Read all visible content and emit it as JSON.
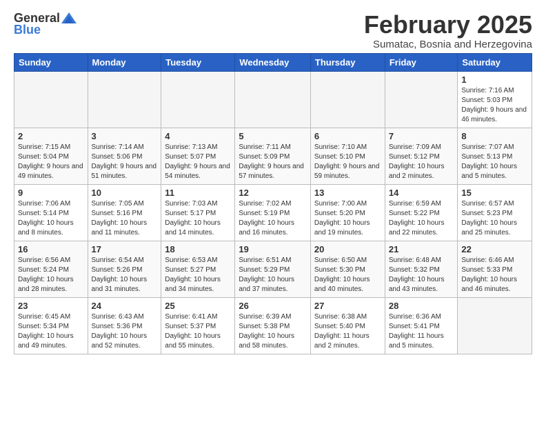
{
  "logo": {
    "general": "General",
    "blue": "Blue"
  },
  "header": {
    "month_year": "February 2025",
    "location": "Sumatac, Bosnia and Herzegovina"
  },
  "weekdays": [
    "Sunday",
    "Monday",
    "Tuesday",
    "Wednesday",
    "Thursday",
    "Friday",
    "Saturday"
  ],
  "weeks": [
    [
      {
        "day": "",
        "info": ""
      },
      {
        "day": "",
        "info": ""
      },
      {
        "day": "",
        "info": ""
      },
      {
        "day": "",
        "info": ""
      },
      {
        "day": "",
        "info": ""
      },
      {
        "day": "",
        "info": ""
      },
      {
        "day": "1",
        "info": "Sunrise: 7:16 AM\nSunset: 5:03 PM\nDaylight: 9 hours and 46 minutes."
      }
    ],
    [
      {
        "day": "2",
        "info": "Sunrise: 7:15 AM\nSunset: 5:04 PM\nDaylight: 9 hours and 49 minutes."
      },
      {
        "day": "3",
        "info": "Sunrise: 7:14 AM\nSunset: 5:06 PM\nDaylight: 9 hours and 51 minutes."
      },
      {
        "day": "4",
        "info": "Sunrise: 7:13 AM\nSunset: 5:07 PM\nDaylight: 9 hours and 54 minutes."
      },
      {
        "day": "5",
        "info": "Sunrise: 7:11 AM\nSunset: 5:09 PM\nDaylight: 9 hours and 57 minutes."
      },
      {
        "day": "6",
        "info": "Sunrise: 7:10 AM\nSunset: 5:10 PM\nDaylight: 9 hours and 59 minutes."
      },
      {
        "day": "7",
        "info": "Sunrise: 7:09 AM\nSunset: 5:12 PM\nDaylight: 10 hours and 2 minutes."
      },
      {
        "day": "8",
        "info": "Sunrise: 7:07 AM\nSunset: 5:13 PM\nDaylight: 10 hours and 5 minutes."
      }
    ],
    [
      {
        "day": "9",
        "info": "Sunrise: 7:06 AM\nSunset: 5:14 PM\nDaylight: 10 hours and 8 minutes."
      },
      {
        "day": "10",
        "info": "Sunrise: 7:05 AM\nSunset: 5:16 PM\nDaylight: 10 hours and 11 minutes."
      },
      {
        "day": "11",
        "info": "Sunrise: 7:03 AM\nSunset: 5:17 PM\nDaylight: 10 hours and 14 minutes."
      },
      {
        "day": "12",
        "info": "Sunrise: 7:02 AM\nSunset: 5:19 PM\nDaylight: 10 hours and 16 minutes."
      },
      {
        "day": "13",
        "info": "Sunrise: 7:00 AM\nSunset: 5:20 PM\nDaylight: 10 hours and 19 minutes."
      },
      {
        "day": "14",
        "info": "Sunrise: 6:59 AM\nSunset: 5:22 PM\nDaylight: 10 hours and 22 minutes."
      },
      {
        "day": "15",
        "info": "Sunrise: 6:57 AM\nSunset: 5:23 PM\nDaylight: 10 hours and 25 minutes."
      }
    ],
    [
      {
        "day": "16",
        "info": "Sunrise: 6:56 AM\nSunset: 5:24 PM\nDaylight: 10 hours and 28 minutes."
      },
      {
        "day": "17",
        "info": "Sunrise: 6:54 AM\nSunset: 5:26 PM\nDaylight: 10 hours and 31 minutes."
      },
      {
        "day": "18",
        "info": "Sunrise: 6:53 AM\nSunset: 5:27 PM\nDaylight: 10 hours and 34 minutes."
      },
      {
        "day": "19",
        "info": "Sunrise: 6:51 AM\nSunset: 5:29 PM\nDaylight: 10 hours and 37 minutes."
      },
      {
        "day": "20",
        "info": "Sunrise: 6:50 AM\nSunset: 5:30 PM\nDaylight: 10 hours and 40 minutes."
      },
      {
        "day": "21",
        "info": "Sunrise: 6:48 AM\nSunset: 5:32 PM\nDaylight: 10 hours and 43 minutes."
      },
      {
        "day": "22",
        "info": "Sunrise: 6:46 AM\nSunset: 5:33 PM\nDaylight: 10 hours and 46 minutes."
      }
    ],
    [
      {
        "day": "23",
        "info": "Sunrise: 6:45 AM\nSunset: 5:34 PM\nDaylight: 10 hours and 49 minutes."
      },
      {
        "day": "24",
        "info": "Sunrise: 6:43 AM\nSunset: 5:36 PM\nDaylight: 10 hours and 52 minutes."
      },
      {
        "day": "25",
        "info": "Sunrise: 6:41 AM\nSunset: 5:37 PM\nDaylight: 10 hours and 55 minutes."
      },
      {
        "day": "26",
        "info": "Sunrise: 6:39 AM\nSunset: 5:38 PM\nDaylight: 10 hours and 58 minutes."
      },
      {
        "day": "27",
        "info": "Sunrise: 6:38 AM\nSunset: 5:40 PM\nDaylight: 11 hours and 2 minutes."
      },
      {
        "day": "28",
        "info": "Sunrise: 6:36 AM\nSunset: 5:41 PM\nDaylight: 11 hours and 5 minutes."
      },
      {
        "day": "",
        "info": ""
      }
    ]
  ]
}
